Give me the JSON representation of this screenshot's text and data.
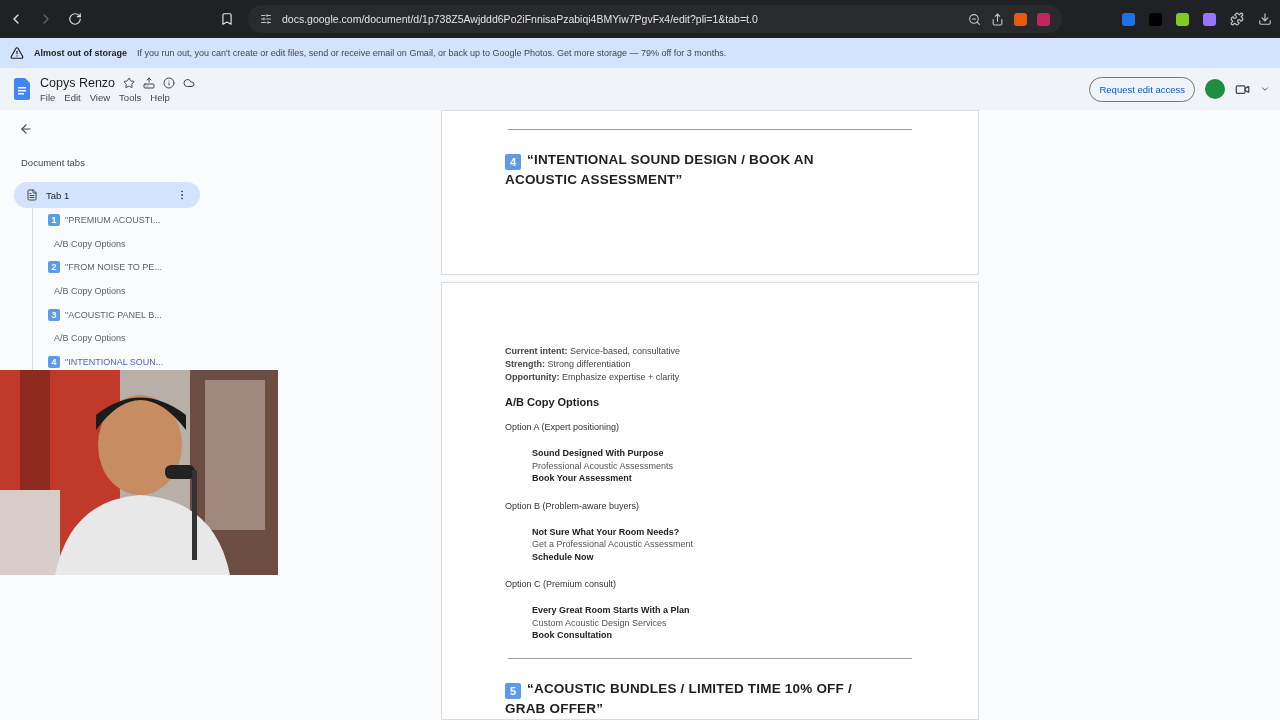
{
  "browser": {
    "url": "docs.google.com/document/d/1p738Z5Awjddd6Po2iFnnisaPzabiqi4BMYiw7PgvFx4/edit?pli=1&tab=t.0"
  },
  "banner": {
    "title": "Almost out of storage",
    "message": "If you run out, you can't create or edit files, send or receive email on Gmail, or back up to Google Photos. Get more storage — 79% off for 3 months."
  },
  "doc": {
    "title": "Copys Renzo",
    "menu": [
      "File",
      "Edit",
      "View",
      "Tools",
      "Help"
    ],
    "request_button": "Request edit access"
  },
  "sidebar": {
    "heading": "Document tabs",
    "tab": {
      "label": "Tab 1",
      "selected": true
    },
    "outline": [
      {
        "badge": "1",
        "text": "\"PREMIUM ACOUSTI...",
        "selected": false,
        "children": [
          {
            "text": "A/B Copy Options"
          }
        ]
      },
      {
        "badge": "2",
        "text": "\"FROM NOISE TO PE...",
        "selected": false,
        "children": [
          {
            "text": "A/B Copy Options"
          }
        ]
      },
      {
        "badge": "3",
        "text": "\"ACOUSTIC PANEL B...",
        "selected": false,
        "children": [
          {
            "text": "A/B Copy Options"
          }
        ]
      },
      {
        "badge": "4",
        "text": "\"INTENTIONAL SOUN...",
        "selected": true
      }
    ]
  },
  "page1": {
    "badge": "4",
    "heading": "“INTENTIONAL SOUND DESIGN / BOOK AN ACOUSTIC ASSESSMENT”"
  },
  "page2": {
    "facts": [
      {
        "label": "Current intent:",
        "value": "Service-based, consultative"
      },
      {
        "label": "Strength:",
        "value": "Strong differentiation"
      },
      {
        "label": "Opportunity:",
        "value": "Emphasize expertise + clarity"
      }
    ],
    "section": "A/B Copy Options",
    "options": [
      {
        "title": "Option A (Expert positioning)",
        "lines": [
          {
            "kind": "headline",
            "text": "Sound Designed With Purpose"
          },
          {
            "kind": "sub",
            "text": "Professional Acoustic Assessments"
          },
          {
            "kind": "cta",
            "text": "Book Your Assessment"
          }
        ]
      },
      {
        "title": "Option B (Problem-aware buyers)",
        "lines": [
          {
            "kind": "headline",
            "text": "Not Sure What Your Room Needs?"
          },
          {
            "kind": "sub",
            "text": "Get a Professional Acoustic Assessment"
          },
          {
            "kind": "cta",
            "text": "Schedule Now"
          }
        ]
      },
      {
        "title": "Option C (Premium consult)",
        "lines": [
          {
            "kind": "headline",
            "text": "Every Great Room Starts With a Plan"
          },
          {
            "kind": "sub",
            "text": "Custom Acoustic Design Services"
          },
          {
            "kind": "cta",
            "text": "Book Consultation"
          }
        ]
      }
    ],
    "next": {
      "badge": "5",
      "heading": "“ACOUSTIC BUNDLES / LIMITED TIME 10% OFF / GRAB OFFER”"
    }
  }
}
